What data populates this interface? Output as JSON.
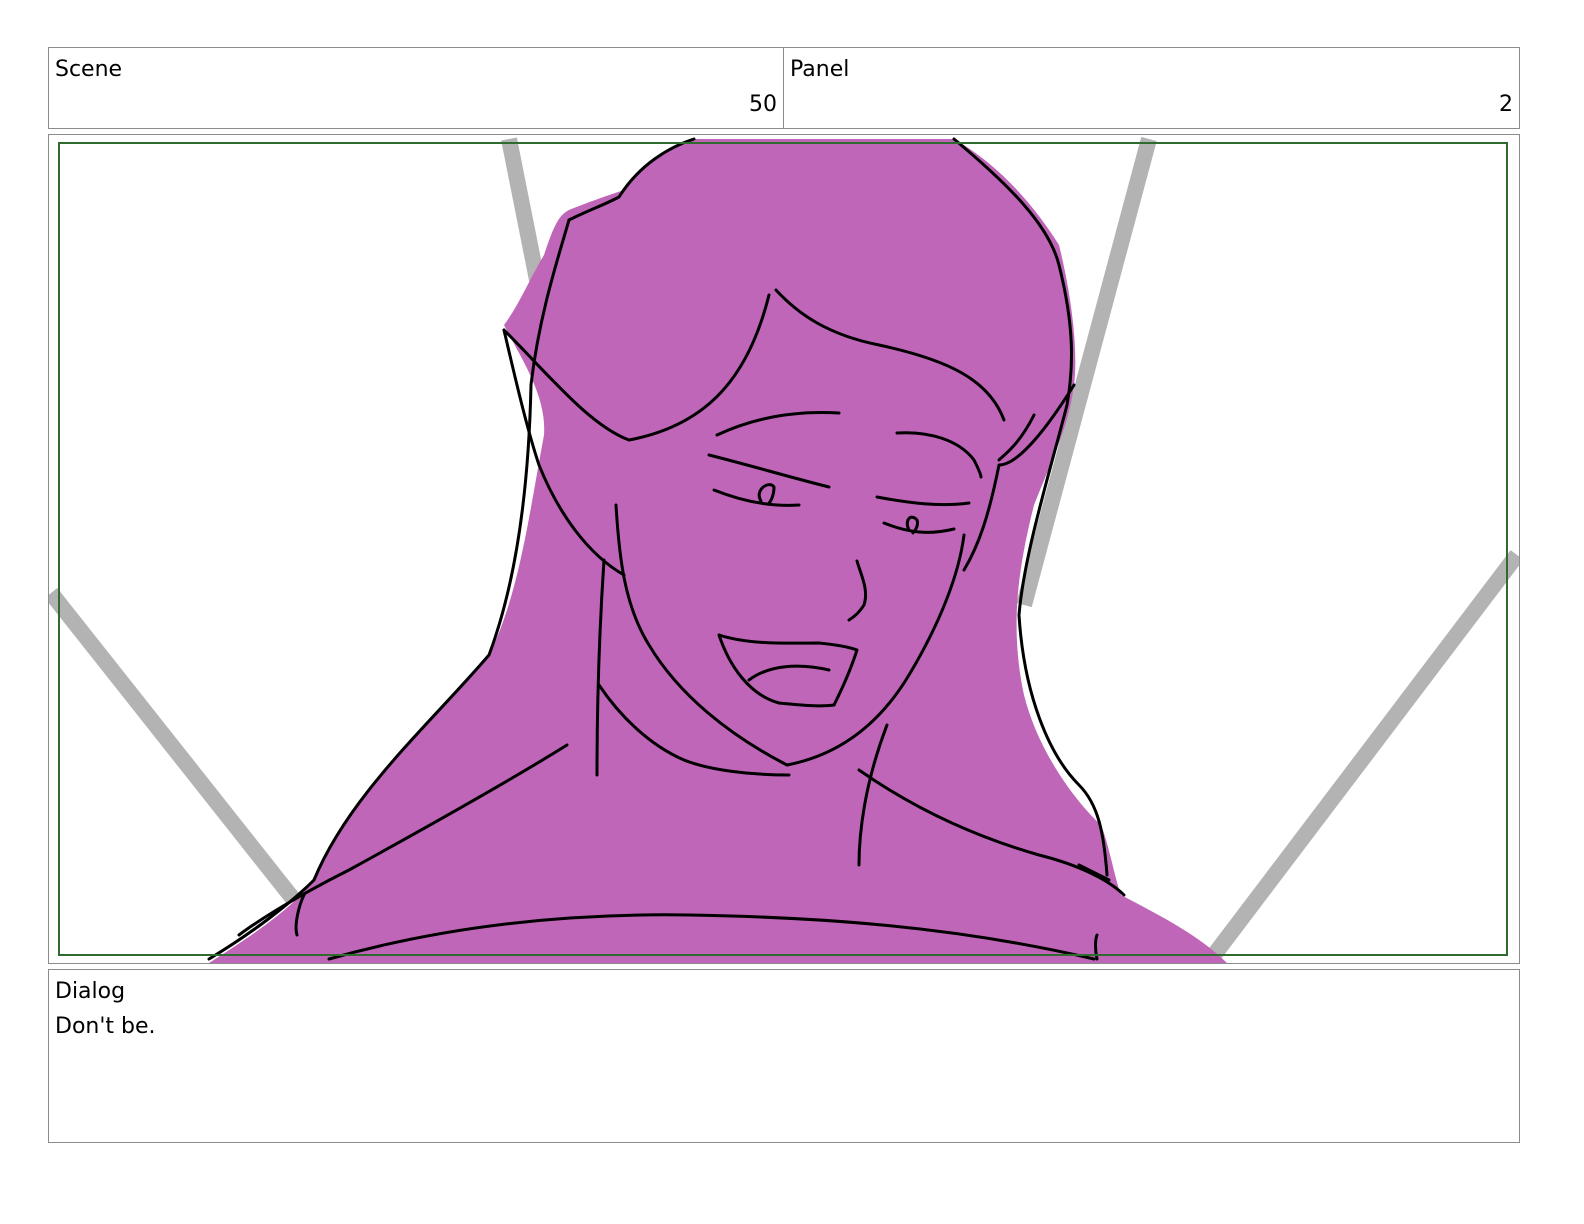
{
  "scene": {
    "label": "Scene",
    "number": "50"
  },
  "panel": {
    "label": "Panel",
    "number": "2"
  },
  "dialog": {
    "label": "Dialog",
    "text": "Don't be."
  },
  "colors": {
    "frame_border": "#8c8c8c",
    "safe_area": "#2f6b2f",
    "fill": "#bf66b8",
    "rays": "#b3b3b3",
    "ink": "#000000"
  },
  "illustration": {
    "subject": "sketch of a long-haired character with pointed ears, mouth open, looking down",
    "icon": "storyboard-sketch"
  }
}
